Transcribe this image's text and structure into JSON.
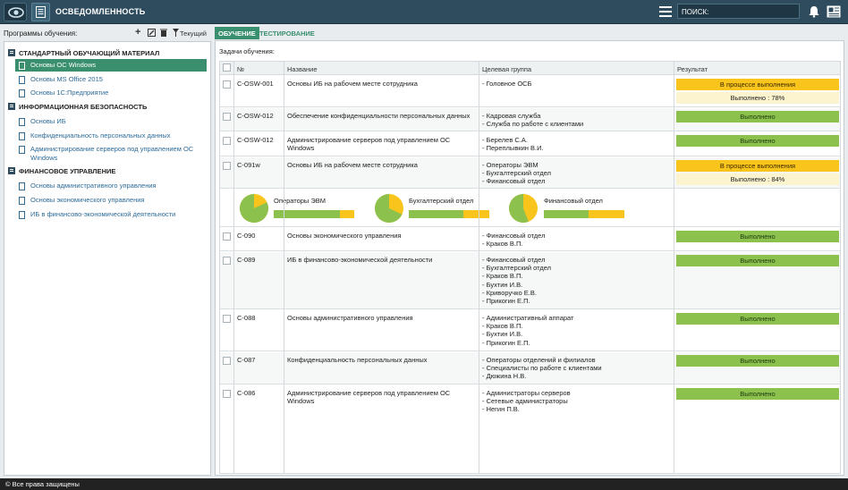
{
  "header": {
    "title": "ОСВЕДОМЛЕННОСТЬ",
    "search_label": "ПОИСК:",
    "search_value": "",
    "icons": [
      "eye-logo-icon",
      "document-icon",
      "menu-icon",
      "bell-icon",
      "news-icon"
    ]
  },
  "left": {
    "label": "Программы обучения:",
    "current_label": "Текущий",
    "groups": [
      {
        "title": "СТАНДАРТНЫЙ ОБУЧАЮЩИЙ МАТЕРИАЛ",
        "items": [
          "Основы ОС Windows",
          "Основы MS Office 2015",
          "Основы 1С:Предприятие"
        ]
      },
      {
        "title": "ИНФОРМАЦИОННАЯ БЕЗОПАСНОСТЬ",
        "items": [
          "Основы ИБ",
          "Конфиденциальность персональных данных",
          "Администрирование серверов под управлением ОС Windows"
        ]
      },
      {
        "title": "ФИНАНСОВОЕ УПРАВЛЕНИЕ",
        "items": [
          "Основы административного управления",
          "Основы экономического управления",
          "ИБ в финансово-экономической деятельности"
        ]
      }
    ]
  },
  "tabs": [
    "ОБУЧЕНИЕ",
    "ТЕСТИРОВАНИЕ"
  ],
  "tasks_label": "Задачи обучения:",
  "table": {
    "headers": [
      "№",
      "Название",
      "Целевая группа",
      "Результат"
    ],
    "rows": [
      {
        "id": "C-OSW-001",
        "name": "Основы ИБ на рабочем месте сотрудника",
        "group": "- Головное ОСБ",
        "result": "В процессе выполнения",
        "note": "Выполнено : 78%"
      },
      {
        "id": "C-OSW-012",
        "name": "Обеспечение конфиденциальности персональных данных",
        "group": "- Кадровая служба\n- Служба по работе с клиентами",
        "result": "Выполнено"
      },
      {
        "id": "C-OSW-012",
        "name": "Администрирование серверов под управлением ОС Windows",
        "group": "- Берелев С.А.\n- Переплывкин В.И.",
        "result": "Выполнено"
      },
      {
        "id": "C-091w",
        "name": "Основы ИБ на рабочем месте сотрудника",
        "group": "- Операторы ЭВМ\n- Бухгалтерский отдел\n- Финансовый отдел",
        "result": "В процессе выполнения",
        "note": "Выполнено : 84%"
      },
      {
        "id": "C-090",
        "name": "Основы экономического управления",
        "group": "- Финансовый отдел\n- Краков В.П.",
        "result": "Выполнено"
      },
      {
        "id": "C-089",
        "name": "ИБ в финансово-экономической деятельности",
        "group": "- Финансовый отдел\n- Бухгалтерский отдел\n- Краков В.П.\n- Бухтин И.В.\n- Криворучко Е.В.\n- Прикогин Е.П.",
        "result": "Выполнено"
      },
      {
        "id": "C-088",
        "name": "Основы административного управления",
        "group": "- Административный аппарат\n- Краков В.П.\n- Бухтин И.В.\n- Прикогин Е.П.",
        "result": "Выполнено"
      },
      {
        "id": "C-087",
        "name": "Конфиденциальность персональных данных",
        "group": "- Операторы отделений и филиалов\n- Специалисты по работе с клиентами\n- Дюжина Н.В.",
        "result": "Выполнено"
      },
      {
        "id": "C-086",
        "name": "Администрирование серверов под управлением ОС Windows",
        "group": "- Администраторы серверов\n- Сетевые администраторы\n- Негин П.В.",
        "result": "Выполнено"
      }
    ]
  },
  "departments": [
    {
      "name": "Операторы ЭВМ",
      "done": 0.82
    },
    {
      "name": "Бухгалтерский отдел",
      "done": 0.68
    },
    {
      "name": "Финансовый отдел",
      "done": 0.56
    }
  ],
  "colors": {
    "header": "#2e4c5d",
    "accent": "#3a8f6f",
    "done": "#8cc14e",
    "progress": "#f9c51c"
  },
  "footer": "© Все права защищены"
}
